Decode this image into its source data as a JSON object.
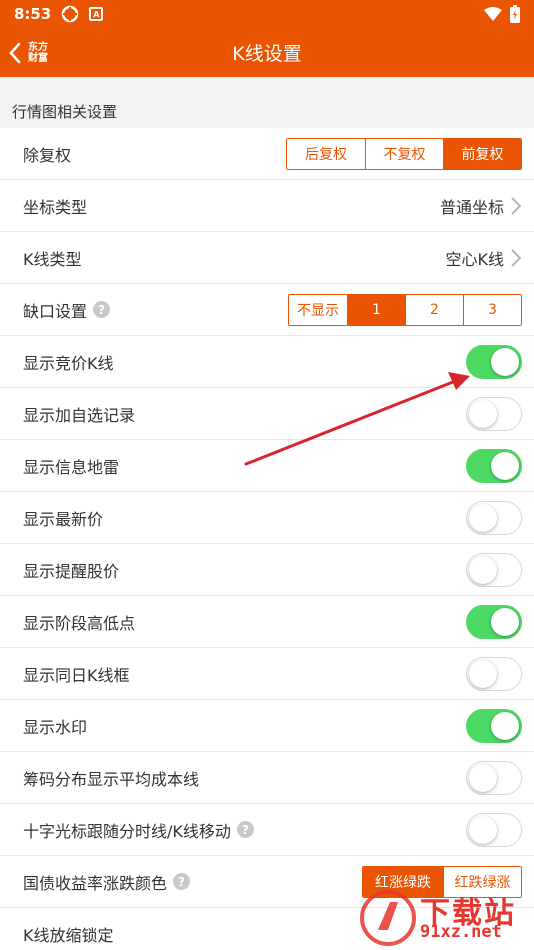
{
  "status_bar": {
    "time": "8:53",
    "app_badge": "A"
  },
  "nav": {
    "brand": "东方财富",
    "brand_line1": "东方",
    "brand_line2": "财富",
    "title": "K线设置"
  },
  "section_title": "行情图相关设置",
  "rows": {
    "fuquan": {
      "label": "除复权",
      "options": [
        "后复权",
        "不复权",
        "前复权"
      ],
      "selected": "前复权"
    },
    "axis_type": {
      "label": "坐标类型",
      "value": "普通坐标"
    },
    "kline_type": {
      "label": "K线类型",
      "value": "空心K线"
    },
    "gap": {
      "label": "缺口设置",
      "options": [
        "不显示",
        "1",
        "2",
        "3"
      ],
      "selected": "1"
    },
    "bid_kline": {
      "label": "显示竞价K线",
      "on": true
    },
    "watchlist_record": {
      "label": "显示加自选记录",
      "on": false
    },
    "info_mine": {
      "label": "显示信息地雷",
      "on": true
    },
    "latest_price": {
      "label": "显示最新价",
      "on": false
    },
    "alert_price": {
      "label": "显示提醒股价",
      "on": false
    },
    "stage_high_low": {
      "label": "显示阶段高低点",
      "on": true
    },
    "same_day_frame": {
      "label": "显示同日K线框",
      "on": false
    },
    "watermark": {
      "label": "显示水印",
      "on": true
    },
    "chip_avg_cost": {
      "label": "筹码分布显示平均成本线",
      "on": false
    },
    "crosshair_follow": {
      "label": "十字光标跟随分时线/K线移动",
      "on": false
    },
    "bond_color": {
      "label": "国债收益率涨跌颜色",
      "options": [
        "红涨绿跌",
        "红跌绿涨"
      ],
      "selected": "红涨绿跌"
    },
    "zoom_lock": {
      "label": "K线放缩锁定"
    }
  },
  "watermark_overlay": {
    "text": "下载站",
    "url": "91xz.net"
  },
  "colors": {
    "brand": "#ea5504",
    "toggle_on": "#4cd964",
    "annotation": "#d9262b"
  }
}
